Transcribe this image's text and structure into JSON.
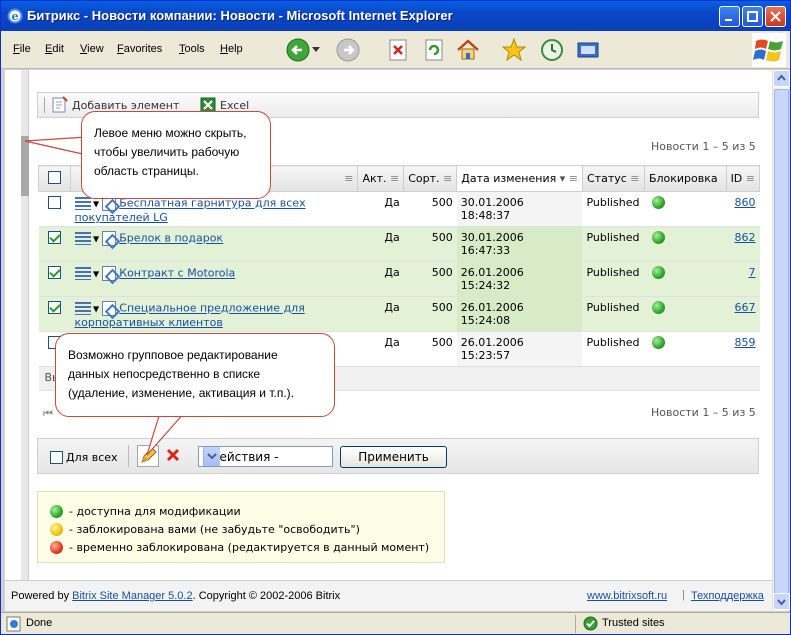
{
  "window": {
    "title": "Битрикс - Новости компании: Новости - Microsoft Internet Explorer"
  },
  "menu": [
    "File",
    "Edit",
    "View",
    "Favorites",
    "Tools",
    "Help"
  ],
  "toolbar": {
    "add_label": "Добавить элемент",
    "excel_label": "Excel"
  },
  "nav": {
    "top": "Новости 1 – 5 из 5",
    "bottom": "Новости 1 – 5 из 5"
  },
  "table": {
    "headers": [
      "Акт.",
      "Сорт.",
      "Дата изменения",
      "Статус",
      "Блокировка",
      "ID"
    ],
    "rows": [
      {
        "checked": false,
        "name": "Бесплатная гарнитура для всех покупателей LG",
        "active": "Да",
        "sort": "500",
        "date": "30.01.2006",
        "time": "18:48:37",
        "status": "Published",
        "id": "860"
      },
      {
        "checked": true,
        "name": "Брелок в подарок",
        "active": "Да",
        "sort": "500",
        "date": "30.01.2006",
        "time": "16:47:33",
        "status": "Published",
        "id": "862"
      },
      {
        "checked": true,
        "name": "Контракт с Motorola",
        "active": "Да",
        "sort": "500",
        "date": "26.01.2006",
        "time": "15:24:32",
        "status": "Published",
        "id": "7"
      },
      {
        "checked": true,
        "name": "Специальное предложение для корпоративных клиентов",
        "active": "Да",
        "sort": "500",
        "date": "26.01.2006",
        "time": "15:24:08",
        "status": "Published",
        "id": "667"
      },
      {
        "checked": false,
        "name": "",
        "active": "Да",
        "sort": "500",
        "date": "26.01.2006",
        "time": "15:23:57",
        "status": "Published",
        "id": "859"
      }
    ],
    "footer_fragment": "Вь"
  },
  "actions": {
    "all_label": "Для всех",
    "select_value": "- действия -",
    "apply_label": "Применить"
  },
  "legend": [
    "- доступна для модификации",
    "- заблокирована вами (не забудьте \"освободить\")",
    "- временно заблокирована (редактируется в данный момент)"
  ],
  "footer": {
    "powered_prefix": "Powered by ",
    "powered_link": "Bitrix Site Manager 5.0.2",
    "copyright": ". Copyright © 2002-2006 Bitrix",
    "site_link": "www.bitrixsoft.ru",
    "support_link": "Техподдержка"
  },
  "callouts": {
    "left_menu": [
      "Левое меню можно скрыть,",
      "чтобы увеличить рабочую",
      "область страницы."
    ],
    "group_edit": [
      "Возможно групповое редактирование",
      "данных непосредственно в списке",
      "(удаление, изменение, активация и т.п.)."
    ]
  },
  "status": {
    "left": "Done",
    "right": "Trusted sites"
  },
  "colors": {
    "title_bar": "#0a47c9",
    "selected_row": "#e3f2d7",
    "callout_border": "#c9473b"
  }
}
